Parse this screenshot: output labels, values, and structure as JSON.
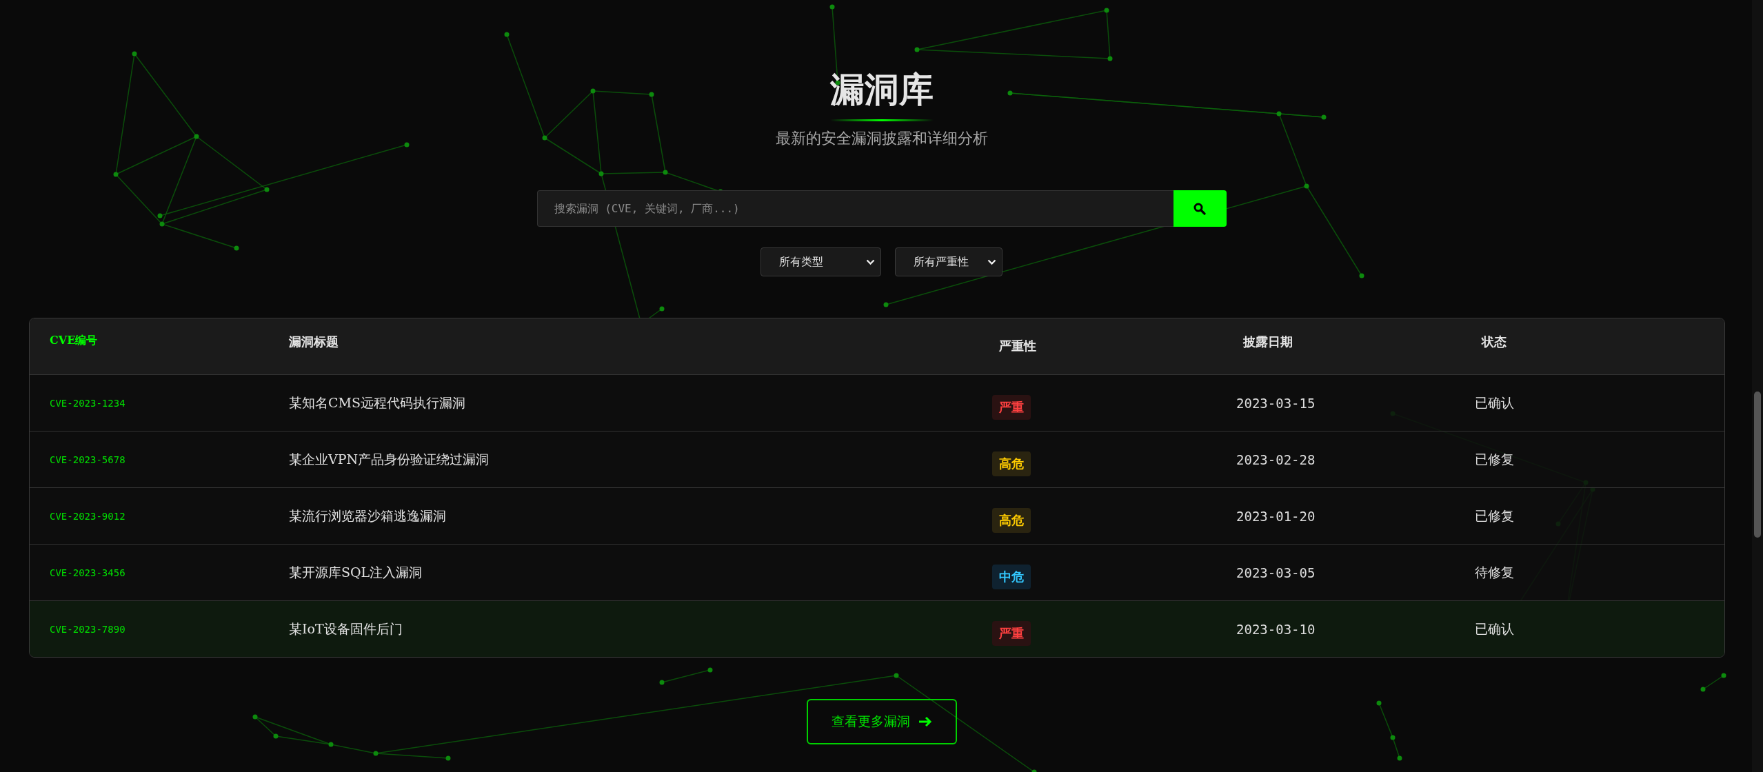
{
  "header": {
    "title": "漏洞库",
    "subtitle": "最新的安全漏洞披露和详细分析"
  },
  "search": {
    "placeholder": "搜索漏洞 (CVE, 关键词, 厂商...)"
  },
  "filters": [
    {
      "value": "所有类型"
    },
    {
      "value": "所有严重性"
    }
  ],
  "table": {
    "columns": [
      "CVE编号",
      "漏洞标题",
      "严重性",
      "披露日期",
      "状态"
    ],
    "rows": [
      {
        "cve": "CVE-2023-1234",
        "title": "某知名CMS远程代码执行漏洞",
        "severity": {
          "label": "严重",
          "kind": "critical"
        },
        "date": "2023-03-15",
        "status": "已确认",
        "selected": false
      },
      {
        "cve": "CVE-2023-5678",
        "title": "某企业VPN产品身份验证绕过漏洞",
        "severity": {
          "label": "高危",
          "kind": "high"
        },
        "date": "2023-02-28",
        "status": "已修复",
        "selected": false
      },
      {
        "cve": "CVE-2023-9012",
        "title": "某流行浏览器沙箱逃逸漏洞",
        "severity": {
          "label": "高危",
          "kind": "high"
        },
        "date": "2023-01-20",
        "status": "已修复",
        "selected": false
      },
      {
        "cve": "CVE-2023-3456",
        "title": "某开源库SQL注入漏洞",
        "severity": {
          "label": "中危",
          "kind": "medium"
        },
        "date": "2023-03-05",
        "status": "待修复",
        "selected": false
      },
      {
        "cve": "CVE-2023-7890",
        "title": "某IoT设备固件后门",
        "severity": {
          "label": "严重",
          "kind": "critical"
        },
        "date": "2023-03-10",
        "status": "已确认",
        "selected": true
      }
    ]
  },
  "more_button": {
    "label": "查看更多漏洞"
  }
}
